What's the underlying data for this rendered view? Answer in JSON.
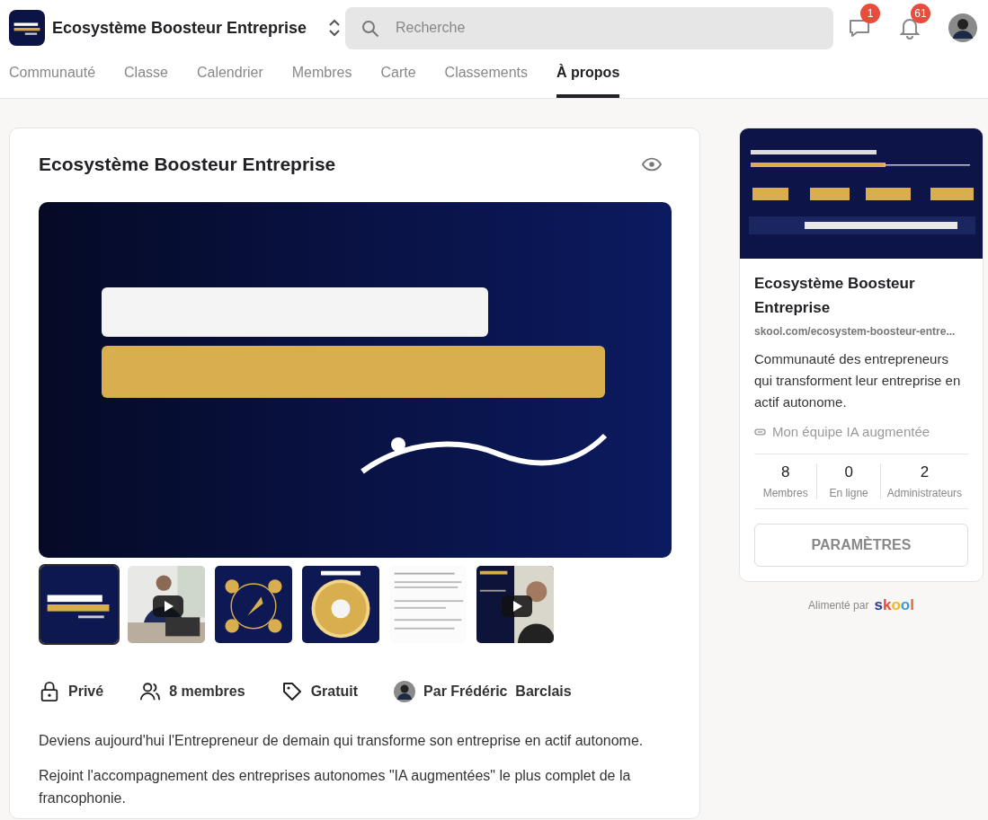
{
  "header": {
    "group_name": "Ecosystème Boosteur Entreprise",
    "search": {
      "placeholder": "Recherche"
    },
    "chat_badge": "1",
    "notification_badge": "61"
  },
  "tabs": [
    {
      "label": "Communauté",
      "selected": false
    },
    {
      "label": "Classe",
      "selected": false
    },
    {
      "label": "Calendrier",
      "selected": false
    },
    {
      "label": "Membres",
      "selected": false
    },
    {
      "label": "Carte",
      "selected": false
    },
    {
      "label": "Classements",
      "selected": false
    },
    {
      "label": "À propos",
      "selected": true
    }
  ],
  "about": {
    "title": "Ecosystème Boosteur Entreprise",
    "gallery": [
      {
        "selected": true,
        "video": false
      },
      {
        "selected": false,
        "video": true
      },
      {
        "selected": false,
        "video": false
      },
      {
        "selected": false,
        "video": false
      },
      {
        "selected": false,
        "video": false
      },
      {
        "selected": false,
        "video": true
      }
    ],
    "meta": [
      {
        "kind": "privacy",
        "label": "Privé"
      },
      {
        "kind": "members",
        "label": "8 membres"
      },
      {
        "kind": "price",
        "label": "Gratuit"
      },
      {
        "kind": "owner",
        "label": "Par Frédéric  Barclais"
      }
    ],
    "description": [
      "Deviens aujourd'hui l'Entrepreneur de demain qui transforme son entreprise en actif autonome.",
      "Rejoint l'accompagnement des entreprises autonomes \"IA augmentées\" le plus complet de la francophonie."
    ]
  },
  "sidebar": {
    "name": "Ecosystème Boosteur Entreprise",
    "url": "skool.com/ecosystem-boosteur-entre...",
    "summary": "Communauté des entrepreneurs qui transforment leur entreprise en actif autonome.",
    "link": "Mon équipe IA augmentée",
    "stats": [
      {
        "value": "8",
        "label": "Membres"
      },
      {
        "value": "0",
        "label": "En ligne"
      },
      {
        "value": "2",
        "label": "Administrateurs"
      }
    ],
    "settings_button": "PARAMÈTRES"
  },
  "powered_by": {
    "label": "Alimenté par",
    "logo": "skool"
  }
}
